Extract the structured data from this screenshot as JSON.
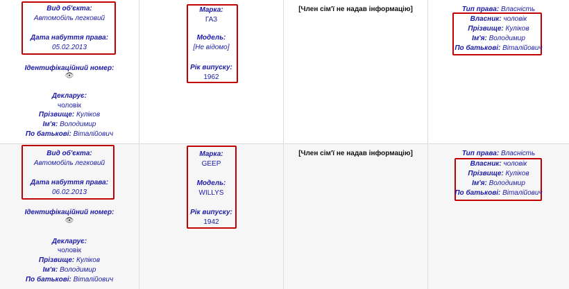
{
  "rows": [
    {
      "object": {
        "kind_label": "Вид об'єкта:",
        "kind_value": "Автомобіль легковий",
        "date_label": "Дата набуття права:",
        "date_value": "05.02.2013",
        "id_label": "Ідентифікаційний номер:",
        "id_icon": "eye-hidden-icon",
        "declarant_label": "Декларує:",
        "declarant_value": "чоловік",
        "surname_label": "Прізвище:",
        "surname_value": "Куліков",
        "name_label": "Ім'я:",
        "name_value": "Володимир",
        "patronymic_label": "По батькові:",
        "patronymic_value": "Віталійович"
      },
      "vehicle": {
        "brand_label": "Марка:",
        "brand_value": "ГАЗ",
        "model_label": "Модель:",
        "model_value": "[Не відомо]",
        "year_label": "Рік випуску:",
        "year_value": "1962"
      },
      "family_note": "[Член сім'ї не надав інформацію]",
      "rights": {
        "type_label": "Тип права:",
        "type_value": "Власність",
        "owner_label": "Власник:",
        "owner_value": "чоловік",
        "surname_label": "Прізвище:",
        "surname_value": "Куліков",
        "name_label": "Ім'я:",
        "name_value": "Володимир",
        "patronymic_label": "По батькові:",
        "patronymic_value": "Віталійович"
      }
    },
    {
      "object": {
        "kind_label": "Вид об'єкта:",
        "kind_value": "Автомобіль легковий",
        "date_label": "Дата набуття права:",
        "date_value": "06.02.2013",
        "id_label": "Ідентифікаційний номер:",
        "id_icon": "eye-hidden-icon",
        "declarant_label": "Декларує:",
        "declarant_value": "чоловік",
        "surname_label": "Прізвище:",
        "surname_value": "Куліков",
        "name_label": "Ім'я:",
        "name_value": "Володимир",
        "patronymic_label": "По батькові:",
        "patronymic_value": "Віталійович"
      },
      "vehicle": {
        "brand_label": "Марка:",
        "brand_value": "GEEP",
        "model_label": "Модель:",
        "model_value": "WILLYS",
        "year_label": "Рік випуску:",
        "year_value": "1942"
      },
      "family_note": "[Член сім'ї не надав інформацію]",
      "rights": {
        "type_label": "Тип права:",
        "type_value": "Власність",
        "owner_label": "Власник:",
        "owner_value": "чоловік",
        "surname_label": "Прізвище:",
        "surname_value": "Куліков",
        "name_label": "Ім'я:",
        "name_value": "Володимир",
        "patronymic_label": "По батькові:",
        "patronymic_value": "Віталійович"
      }
    }
  ],
  "colors": {
    "text": "#1a1aa6",
    "highlight": "#c00000",
    "row_alt": "#f6f6f6",
    "border": "#dcdcdc"
  }
}
